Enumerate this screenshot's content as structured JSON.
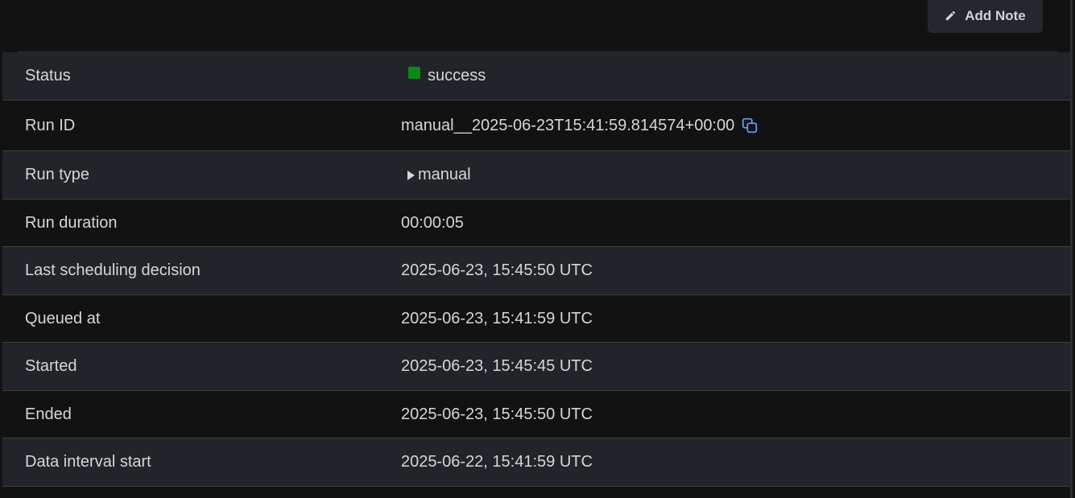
{
  "toolbar": {
    "add_note_label": "Add Note"
  },
  "details": {
    "rows": [
      {
        "label": "Status",
        "value": "success"
      },
      {
        "label": "Run ID",
        "value": "manual__2025-06-23T15:41:59.814574+00:00"
      },
      {
        "label": "Run type",
        "value": "manual"
      },
      {
        "label": "Run duration",
        "value": "00:00:05"
      },
      {
        "label": "Last scheduling decision",
        "value": "2025-06-23, 15:45:50 UTC"
      },
      {
        "label": "Queued at",
        "value": "2025-06-23, 15:41:59 UTC"
      },
      {
        "label": "Started",
        "value": "2025-06-23, 15:45:45 UTC"
      },
      {
        "label": "Ended",
        "value": "2025-06-23, 15:45:50 UTC"
      },
      {
        "label": "Data interval start",
        "value": "2025-06-22, 15:41:59 UTC"
      }
    ]
  },
  "icons": {
    "add_note": "pencil-icon",
    "copy": "copy-icon",
    "run_type": "play-triangle-icon"
  },
  "colors": {
    "status_success": "#0a8a16",
    "copy_icon": "#5b9cf2"
  }
}
